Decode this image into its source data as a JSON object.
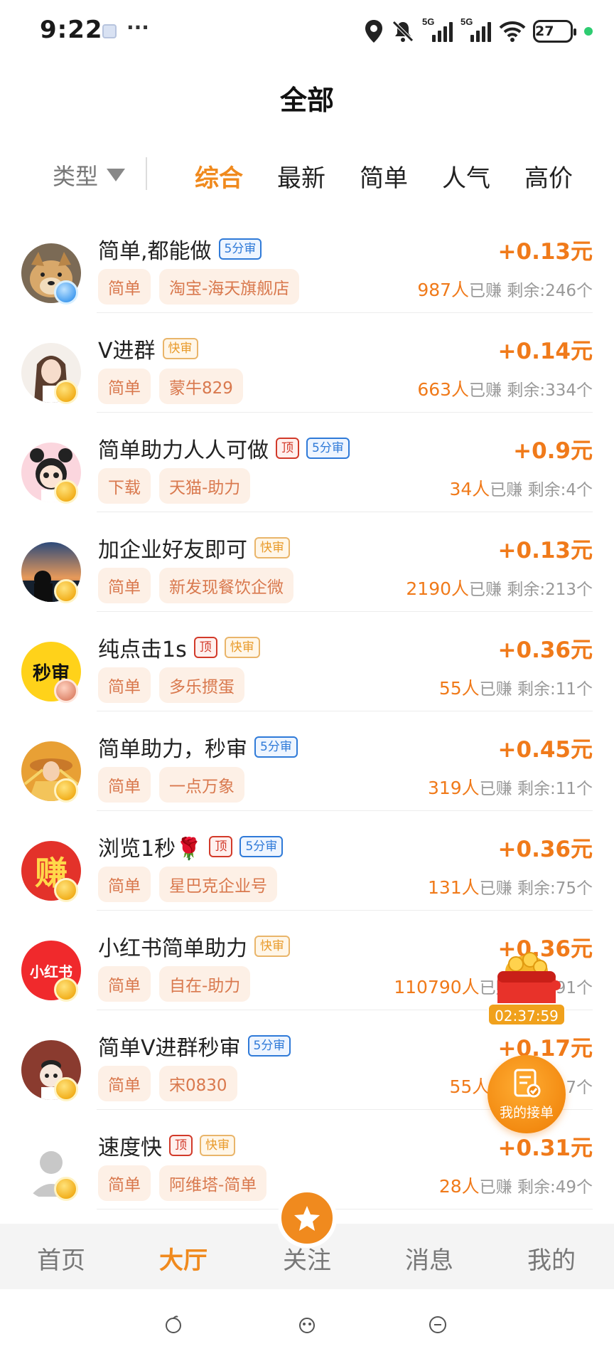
{
  "status_bar": {
    "time": "9:22",
    "more": "···",
    "net1": "5G",
    "net2": "5G",
    "battery": "27",
    "icons": [
      "location-icon",
      "mute-icon",
      "signal-5g-icon",
      "signal-5g-icon",
      "wifi-icon",
      "battery-icon"
    ]
  },
  "header": {
    "title": "全部"
  },
  "filters": {
    "type_label": "类型",
    "sorts": [
      "综合",
      "最新",
      "简单",
      "人气",
      "高价"
    ],
    "active_sort": "综合"
  },
  "tasks": [
    {
      "title": "简单,都能做",
      "tags": [
        {
          "text": "5分审",
          "style": "blue"
        }
      ],
      "price": "+0.13元",
      "chips": [
        "简单",
        "淘宝-海天旗舰店"
      ],
      "earned": "987人",
      "earned_label": "已赚",
      "remain": "剩余:246个",
      "avatar": "dog",
      "badge": "blue"
    },
    {
      "title": "V进群",
      "tags": [
        {
          "text": "快审",
          "style": "orange"
        }
      ],
      "price": "+0.14元",
      "chips": [
        "简单",
        "蒙牛829"
      ],
      "earned": "663人",
      "earned_label": "已赚",
      "remain": "剩余:334个",
      "avatar": "girl",
      "badge": "gold"
    },
    {
      "title": "简单助力人人可做",
      "tags": [
        {
          "text": "顶",
          "style": "red"
        },
        {
          "text": "5分审",
          "style": "blue"
        }
      ],
      "price": "+0.9元",
      "chips": [
        "下载",
        "天猫-助力"
      ],
      "earned": "34人",
      "earned_label": "已赚",
      "remain": "剩余:4个",
      "avatar": "pink",
      "badge": "gold"
    },
    {
      "title": "加企业好友即可",
      "tags": [
        {
          "text": "快审",
          "style": "orange"
        }
      ],
      "price": "+0.13元",
      "chips": [
        "简单",
        "新发现餐饮企微"
      ],
      "earned": "2190人",
      "earned_label": "已赚",
      "remain": "剩余:213个",
      "avatar": "sunset",
      "badge": "gold"
    },
    {
      "title": "纯点击1s",
      "tags": [
        {
          "text": "顶",
          "style": "red"
        },
        {
          "text": "快审",
          "style": "orange"
        }
      ],
      "price": "+0.36元",
      "chips": [
        "简单",
        "多乐掼蛋"
      ],
      "earned": "55人",
      "earned_label": "已赚",
      "remain": "剩余:11个",
      "avatar": "text-yellow",
      "avatar_text": "秒审",
      "badge": "bronze"
    },
    {
      "title": "简单助力，秒审",
      "tags": [
        {
          "text": "5分审",
          "style": "blue"
        }
      ],
      "price": "+0.45元",
      "chips": [
        "简单",
        "一点万象"
      ],
      "earned": "319人",
      "earned_label": "已赚",
      "remain": "剩余:11个",
      "avatar": "wheat",
      "badge": "gold"
    },
    {
      "title": "浏览1秒🌹",
      "tags": [
        {
          "text": "顶",
          "style": "red"
        },
        {
          "text": "5分审",
          "style": "blue"
        }
      ],
      "price": "+0.36元",
      "chips": [
        "简单",
        "星巴克企业号"
      ],
      "earned": "131人",
      "earned_label": "已赚",
      "remain": "剩余:75个",
      "avatar": "text-red",
      "avatar_text": "赚",
      "badge": "gold"
    },
    {
      "title": "小红书简单助力",
      "tags": [
        {
          "text": "快审",
          "style": "orange"
        }
      ],
      "price": "+0.36元",
      "chips": [
        "简单",
        "自在-助力"
      ],
      "earned": "110790人",
      "earned_label": "已赚",
      "remain": "剩余:91个",
      "avatar": "text-xhs",
      "avatar_text": "小红书",
      "badge": "gold"
    },
    {
      "title": "简单V进群秒审",
      "tags": [
        {
          "text": "5分审",
          "style": "blue"
        }
      ],
      "price": "+0.17元",
      "chips": [
        "简单",
        "宋0830"
      ],
      "earned": "55人",
      "earned_label": "已赚",
      "remain": "剩余:7个",
      "avatar": "cartoon",
      "badge": "gold"
    },
    {
      "title": "速度快",
      "tags": [
        {
          "text": "顶",
          "style": "red"
        },
        {
          "text": "快审",
          "style": "orange"
        }
      ],
      "price": "+0.31元",
      "chips": [
        "简单",
        "阿维塔-简单"
      ],
      "earned": "28人",
      "earned_label": "已赚",
      "remain": "剩余:49个",
      "avatar": "default",
      "badge": "gold"
    }
  ],
  "floating": {
    "timer": "02:37:59",
    "my_orders": "我的接单"
  },
  "bottom_nav": [
    "首页",
    "大厅",
    "关注",
    "消息",
    "我的"
  ],
  "bottom_nav_active": "大厅",
  "colors": {
    "accent": "#f08a1e",
    "price": "#f07a1a",
    "chip_bg": "#fdf0e6"
  }
}
